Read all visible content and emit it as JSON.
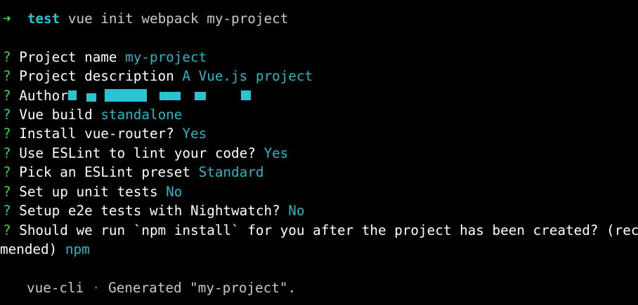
{
  "prompt": {
    "arrow": "➜",
    "directory": "test",
    "command": "vue init webpack my-project"
  },
  "questions": [
    {
      "mark": "?",
      "label": "Project name",
      "answer": "my-project"
    },
    {
      "mark": "?",
      "label": "Project description",
      "answer": "A Vue.js project"
    },
    {
      "mark": "?",
      "label": "Author",
      "answer": ""
    },
    {
      "mark": "?",
      "label": "Vue build",
      "answer": "standalone"
    },
    {
      "mark": "?",
      "label": "Install vue-router?",
      "answer": "Yes"
    },
    {
      "mark": "?",
      "label": "Use ESLint to lint your code?",
      "answer": "Yes"
    },
    {
      "mark": "?",
      "label": "Pick an ESLint preset",
      "answer": "Standard"
    },
    {
      "mark": "?",
      "label": "Set up unit tests",
      "answer": "No"
    },
    {
      "mark": "?",
      "label": "Setup e2e tests with Nightwatch?",
      "answer": "No"
    },
    {
      "mark": "?",
      "label": "Should we run `npm install` for you after the project has been created? (recom",
      "answer": ""
    }
  ],
  "wrap": {
    "text": "mended)",
    "answer": "npm"
  },
  "footer": {
    "tool": "vue-cli",
    "separator": "·",
    "message": "Generated \"my-project\"."
  }
}
